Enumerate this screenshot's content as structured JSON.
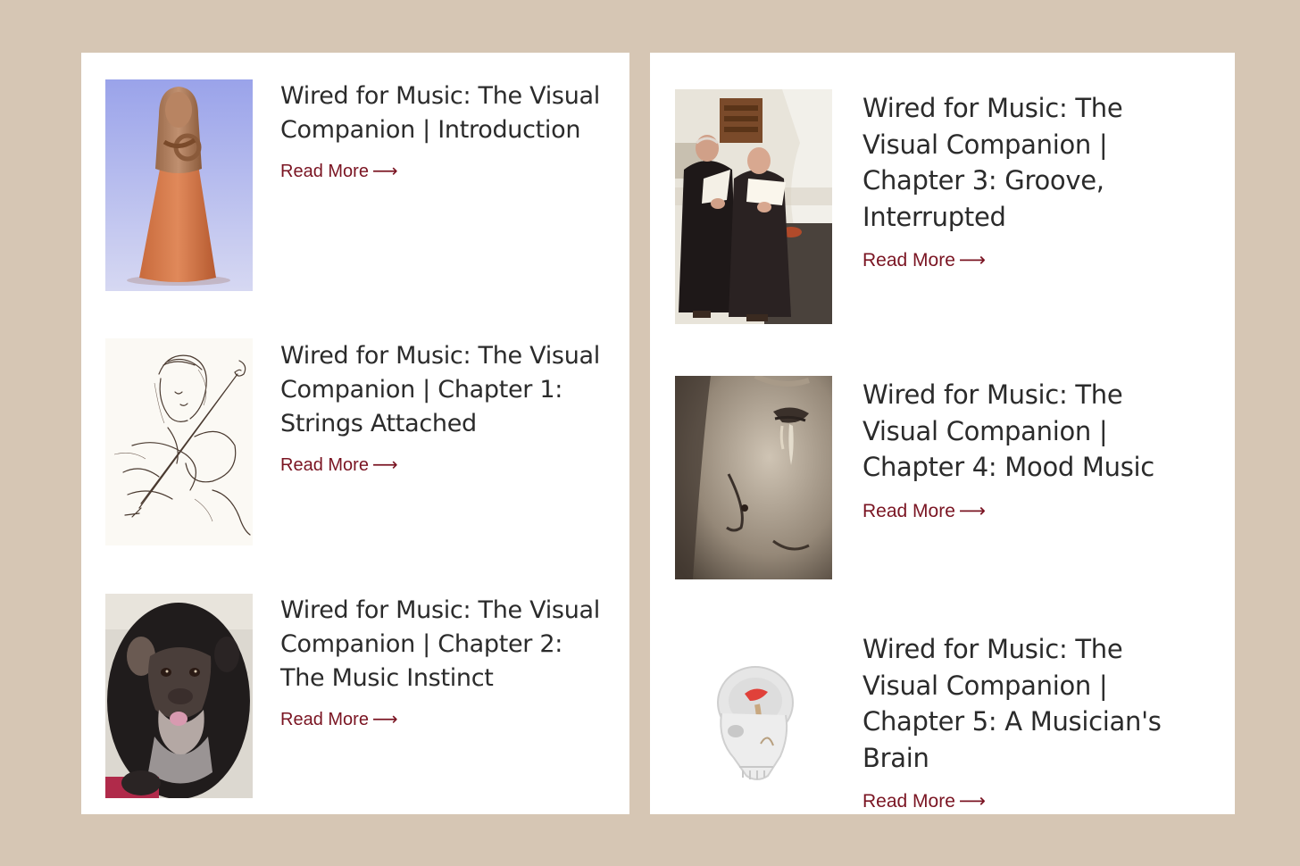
{
  "accent_color": "#7a1422",
  "background_color": "#d6c6b4",
  "columns": [
    {
      "items": [
        {
          "title": "Wired for Music: The Visual Companion | Introduction",
          "read_more": "Read More",
          "arrow": "⟶",
          "image": "terracotta-figurine-image"
        },
        {
          "title": "Wired for Music: The Visual Companion | Chapter 1: Strings Attached",
          "read_more": "Read More",
          "arrow": "⟶",
          "image": "violinist-sketch-image"
        },
        {
          "title": "Wired for Music: The Visual Companion | Chapter 2: The Music Instinct",
          "read_more": "Read More",
          "arrow": "⟶",
          "image": "chimpanzee-image"
        }
      ]
    },
    {
      "items": [
        {
          "title": "Wired for Music: The Visual Companion | Chapter 3: Groove, Interrupted",
          "read_more": "Read More",
          "arrow": "⟶",
          "image": "monks-singing-image"
        },
        {
          "title": "Wired for Music: The Visual Companion | Chapter 4: Mood Music",
          "read_more": "Read More",
          "arrow": "⟶",
          "image": "weeping-statue-image"
        },
        {
          "title": "Wired for Music: The Visual Companion | Chapter 5: A Musician's Brain",
          "read_more": "Read More",
          "arrow": "⟶",
          "image": "skull-brain-image"
        }
      ]
    }
  ]
}
